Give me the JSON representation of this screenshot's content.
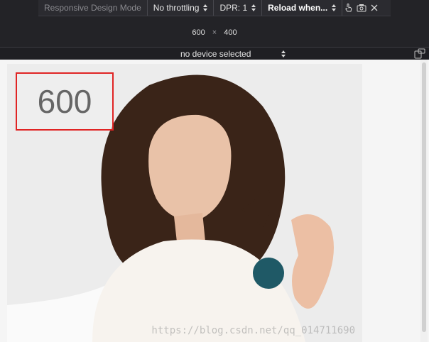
{
  "toolbar": {
    "mode": "Responsive Design Mode",
    "throttling": "No throttling",
    "dpr": "DPR: 1",
    "reload": "Reload when...",
    "icons": [
      "touch-icon",
      "screenshot-icon",
      "close-icon"
    ]
  },
  "dims": {
    "width": "600",
    "sep": "×",
    "height": "400"
  },
  "device": {
    "label": "no device selected"
  },
  "content": {
    "width_label": "600",
    "watermark": "https://blog.csdn.net/qq_014711690"
  }
}
